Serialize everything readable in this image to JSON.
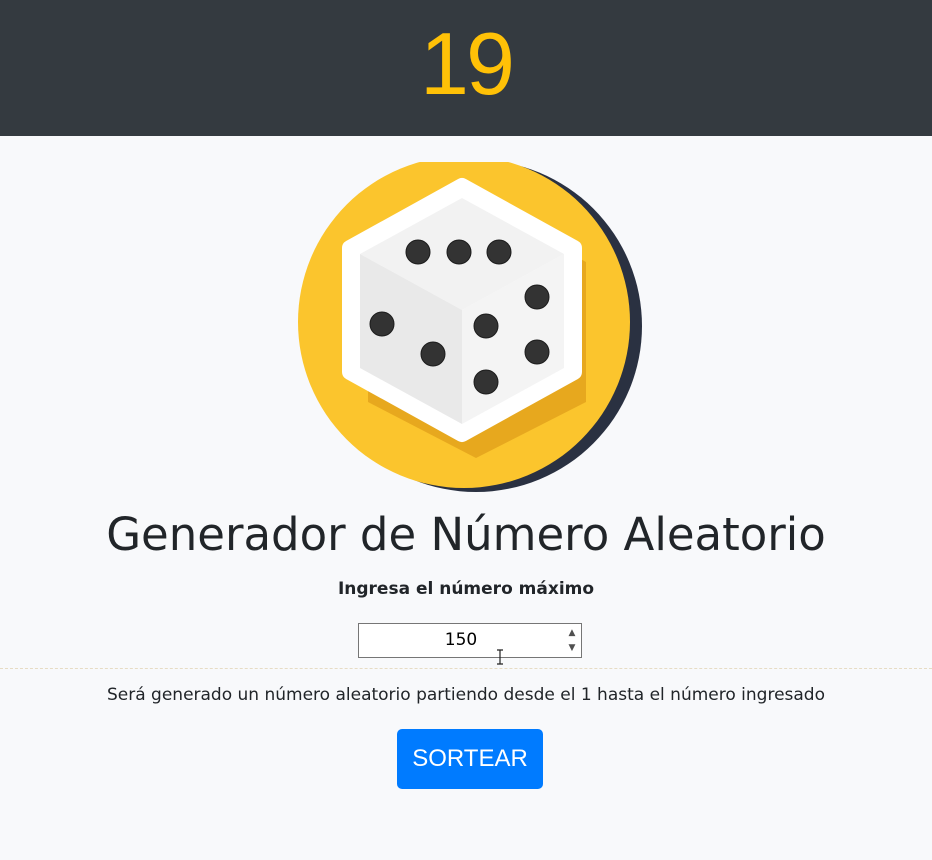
{
  "result": {
    "value": "19"
  },
  "logo": {
    "icon": "dice-icon",
    "colors": {
      "circle": "#fbc52d",
      "shadow": "#2a3141",
      "die": "#eeeeee",
      "pip": "#333333"
    }
  },
  "title": "Generador de Número Aleatorio",
  "form": {
    "label": "Ingresa el número máximo",
    "max_value": "150",
    "spinner": {
      "up": "▲",
      "down": "▼"
    }
  },
  "hint": "Será generado un número aleatorio partiendo desde el 1 hasta el número ingresado",
  "button": {
    "label": "SORTEAR",
    "color": "#007bff"
  },
  "theme": {
    "header_bg": "#343a40",
    "accent": "#ffc107",
    "page_bg": "#f8f9fb"
  }
}
